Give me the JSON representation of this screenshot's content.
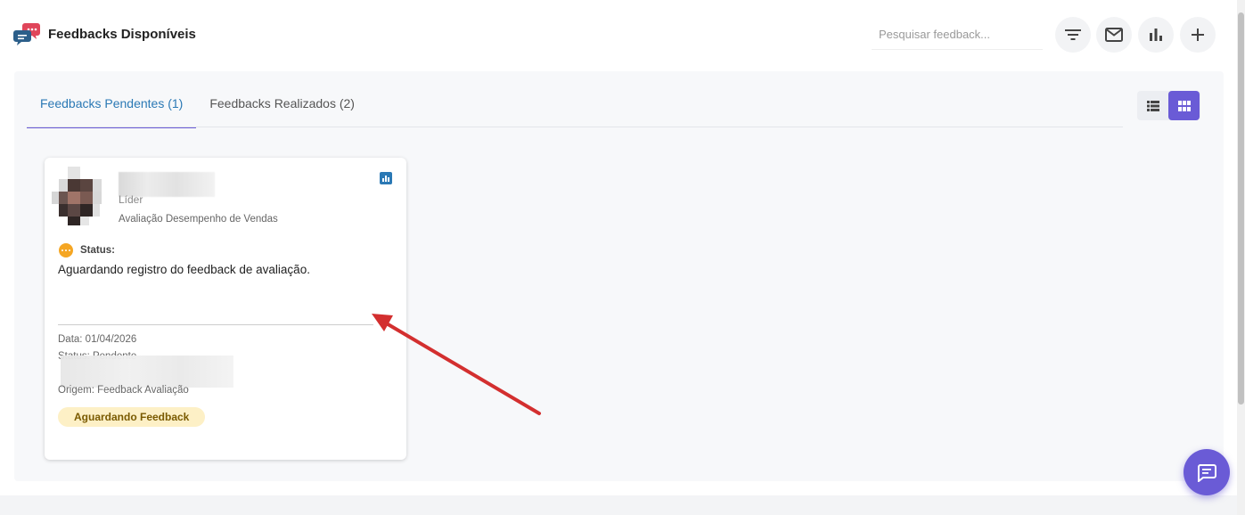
{
  "header": {
    "title": "Feedbacks Disponíveis",
    "search_placeholder": "Pesquisar feedback...",
    "actions": [
      "filter-icon",
      "mail-icon",
      "chart-icon",
      "plus-icon"
    ]
  },
  "tabs": [
    {
      "label": "Feedbacks Pendentes (1)",
      "active": true
    },
    {
      "label": "Feedbacks Realizados (2)",
      "active": false
    }
  ],
  "view_toggle": {
    "selected": "grid"
  },
  "card": {
    "role": "Líder",
    "evaluation": "Avaliação Desempenho de Vendas",
    "status_label": "Status:",
    "status_text": "Aguardando registro do feedback de avaliação.",
    "date": "Data: 01/04/2026",
    "status_meta": "Status: Pendente",
    "origin": "Origem: Feedback Avaliação",
    "badge": "Aguardando Feedback"
  },
  "colors": {
    "accent": "#6a5bd6",
    "tab_active_text": "#2b79b5",
    "status_orange": "#f5a623",
    "badge_bg": "#fdf0c6",
    "arrow": "#d32f2f"
  }
}
